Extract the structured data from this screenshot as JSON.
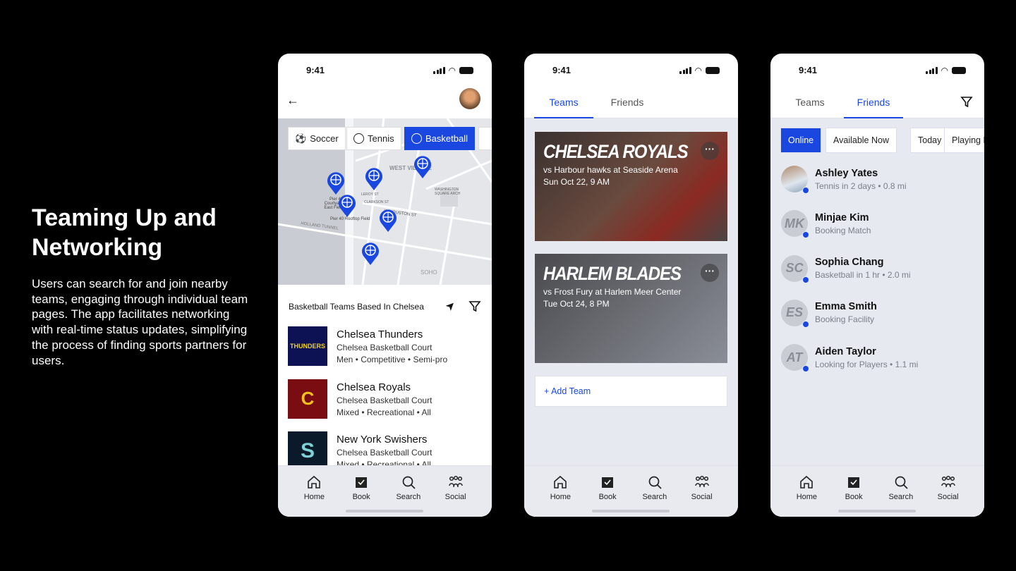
{
  "intro": {
    "title": "Teaming Up and Networking",
    "body": "Users can search for and join nearby teams, engaging through individual team pages. The app facilitates networking with real-time status updates, simplifying the process of finding sports partners for users."
  },
  "status_time": "9:41",
  "accent": "#1a47e0",
  "nav": [
    {
      "label": "Home",
      "icon": "home-icon"
    },
    {
      "label": "Book",
      "icon": "book-icon"
    },
    {
      "label": "Search",
      "icon": "search-icon"
    },
    {
      "label": "Social",
      "icon": "social-icon"
    }
  ],
  "screen1": {
    "chips": [
      {
        "label": "Soccer",
        "icon": "soccer-ball-icon"
      },
      {
        "label": "Tennis",
        "icon": "tennis-ball-icon"
      },
      {
        "label": "Basketball",
        "icon": "basketball-icon",
        "selected": true
      }
    ],
    "map_labels": [
      "WEST VILLAGE",
      "Pier 40 Courtyard East Field",
      "Pier 40 Rooftop Field",
      "HOLLAND TUNNEL",
      "W HOUSTON ST",
      "SOHO",
      "WASHINGTON SQUARE ARCH",
      "LEROY ST",
      "CLARKSON ST"
    ],
    "list_title": "Basketball Teams Based In Chelsea",
    "teams": [
      {
        "name": "Chelsea Thunders",
        "venue": "Chelsea Basketball Court",
        "tags": "Men • Competitive • Semi-pro",
        "logo_text": "THUNDERS",
        "logo_bg": "#0d1255"
      },
      {
        "name": "Chelsea Royals",
        "venue": "Chelsea Basketball Court",
        "tags": "Mixed • Recreational • All",
        "logo_text": "C",
        "logo_bg": "#7a0d12"
      },
      {
        "name": "New York Swishers",
        "venue": "Chelsea Basketball Court",
        "tags": "Mixed • Recreational • All",
        "logo_text": "S",
        "logo_bg": "#0b1a2a"
      }
    ]
  },
  "screen2": {
    "tabs": [
      "Teams",
      "Friends"
    ],
    "cards": [
      {
        "title": "CHELSEA ROYALS",
        "match": "vs Harbour hawks at Seaside Arena",
        "date": "Sun Oct 22, 9 AM"
      },
      {
        "title": "HARLEM BLADES",
        "match": "vs Frost Fury at Harlem Meer Center",
        "date": "Tue Oct 24, 8 PM"
      }
    ],
    "add_team": "+ Add Team"
  },
  "screen3": {
    "tabs": [
      "Teams",
      "Friends"
    ],
    "filters": [
      "Online",
      "Available Now",
      "Today",
      "Playing Now"
    ],
    "friends": [
      {
        "name": "Ashley Yates",
        "status": "Tennis in 2 days • 0.8 mi",
        "initials": ""
      },
      {
        "name": "Minjae Kim",
        "status": "Booking Match",
        "initials": "MK"
      },
      {
        "name": "Sophia Chang",
        "status": "Basketball in 1 hr • 2.0 mi",
        "initials": "SC"
      },
      {
        "name": "Emma Smith",
        "status": "Booking Facility",
        "initials": "ES"
      },
      {
        "name": "Aiden Taylor",
        "status": "Looking for Players • 1.1 mi",
        "initials": "AT"
      }
    ]
  }
}
